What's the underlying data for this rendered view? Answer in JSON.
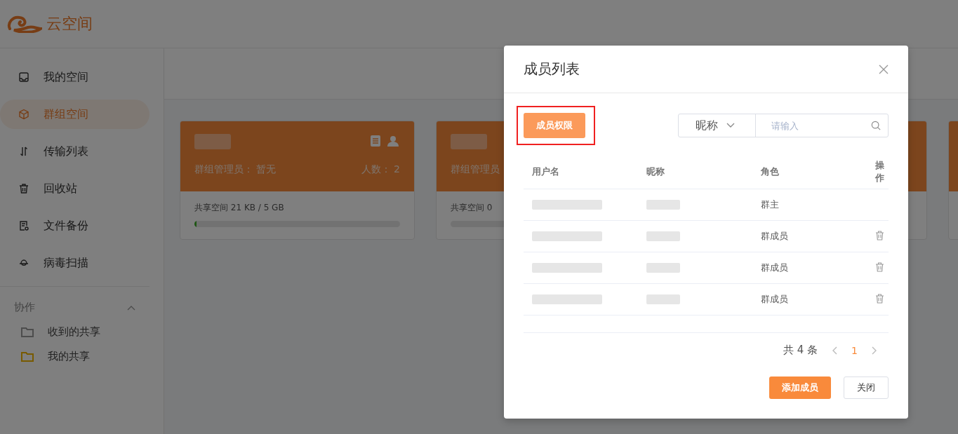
{
  "app": {
    "logo_text": "云空间"
  },
  "sidebar": {
    "items": [
      {
        "label": "我的空间",
        "selected": false
      },
      {
        "label": "群组空间",
        "selected": true
      },
      {
        "label": "传输列表",
        "selected": false
      },
      {
        "label": "回收站",
        "selected": false
      },
      {
        "label": "文件备份",
        "selected": false
      },
      {
        "label": "病毒扫描",
        "selected": false
      }
    ],
    "section": {
      "title": "协作",
      "expanded": true,
      "items": [
        {
          "label": "收到的共享",
          "color": "#4d4d4d"
        },
        {
          "label": "我的共享",
          "color": "#785a00"
        }
      ]
    }
  },
  "cards": [
    {
      "admin_label": "群组管理员：",
      "admin": "暂无",
      "count_label": "人数：",
      "count": "2",
      "storage": "共享空间 21 KB / 5 GB",
      "level": 0.01
    },
    {
      "admin_label": "群组管理员",
      "storage": "共享空间 0"
    }
  ],
  "modal": {
    "title": "成员列表",
    "permissions_button": "成员权限",
    "filter": {
      "field": "昵称",
      "placeholder": "请输入"
    },
    "columns": [
      "用户名",
      "昵称",
      "角色",
      "操作"
    ],
    "rows": [
      {
        "role": "群主",
        "deletable": false
      },
      {
        "role": "群成员",
        "deletable": true
      },
      {
        "role": "群成员",
        "deletable": true
      },
      {
        "role": "群成员",
        "deletable": true
      }
    ],
    "pagination": {
      "total": "共 4 条",
      "pages": [
        {
          "label": "1",
          "selected": true
        }
      ]
    },
    "buttons": [
      {
        "label": "添加成员",
        "kind": "primary"
      },
      {
        "label": "关闭",
        "kind": "default"
      }
    ]
  }
}
